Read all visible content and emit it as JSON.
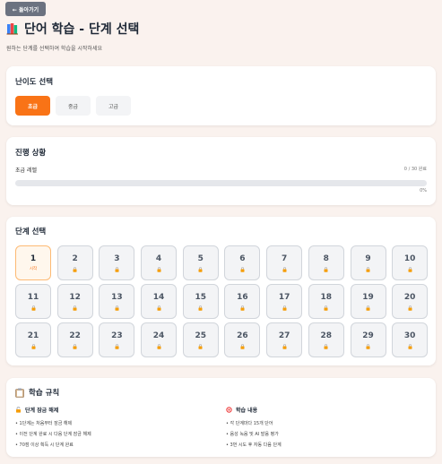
{
  "back_button": {
    "label": "← 돌아가기"
  },
  "header": {
    "title": "단어 학습 - 단계 선택",
    "subtitle": "원하는 단계를 선택하여 학습을 시작하세요"
  },
  "difficulty": {
    "title": "난이도 선택",
    "options": [
      "초급",
      "중급",
      "고급"
    ],
    "selected": "초급"
  },
  "progress": {
    "title": "진행 상황",
    "level_label": "초급 레벨",
    "count_label": "0 / 30 완료",
    "percent_label": "0%",
    "fraction": 0
  },
  "stages": {
    "title": "단계 선택",
    "current_sublabel": "시작",
    "items": [
      "1",
      "2",
      "3",
      "4",
      "5",
      "6",
      "7",
      "8",
      "9",
      "10",
      "11",
      "12",
      "13",
      "14",
      "15",
      "16",
      "17",
      "18",
      "19",
      "20",
      "21",
      "22",
      "23",
      "24",
      "25",
      "26",
      "27",
      "28",
      "29",
      "30"
    ]
  },
  "rules": {
    "title": "학습 규칙",
    "unlock": {
      "title": "단계 잠금 해제",
      "items": [
        "1단계는 처음부터 잠금 해제",
        "이전 단계 완료 시 다음 단계 잠금 해제",
        "70점 이상 획득 시 단계 완료"
      ]
    },
    "content": {
      "title": "학습 내용",
      "items": [
        "각 단계마다 15개 단어",
        "음성 녹음 및 AI 발음 평가",
        "3번 시도 후 자동 다음 단계"
      ]
    }
  },
  "colors": {
    "accent": "#f97316",
    "back_button": "#6b7280",
    "background": "#faf2ee"
  },
  "icons": {
    "title": "books-icon",
    "locked": "lock-icon",
    "rules": "clipboard-icon",
    "unlock": "unlock-icon",
    "content": "target-icon"
  }
}
